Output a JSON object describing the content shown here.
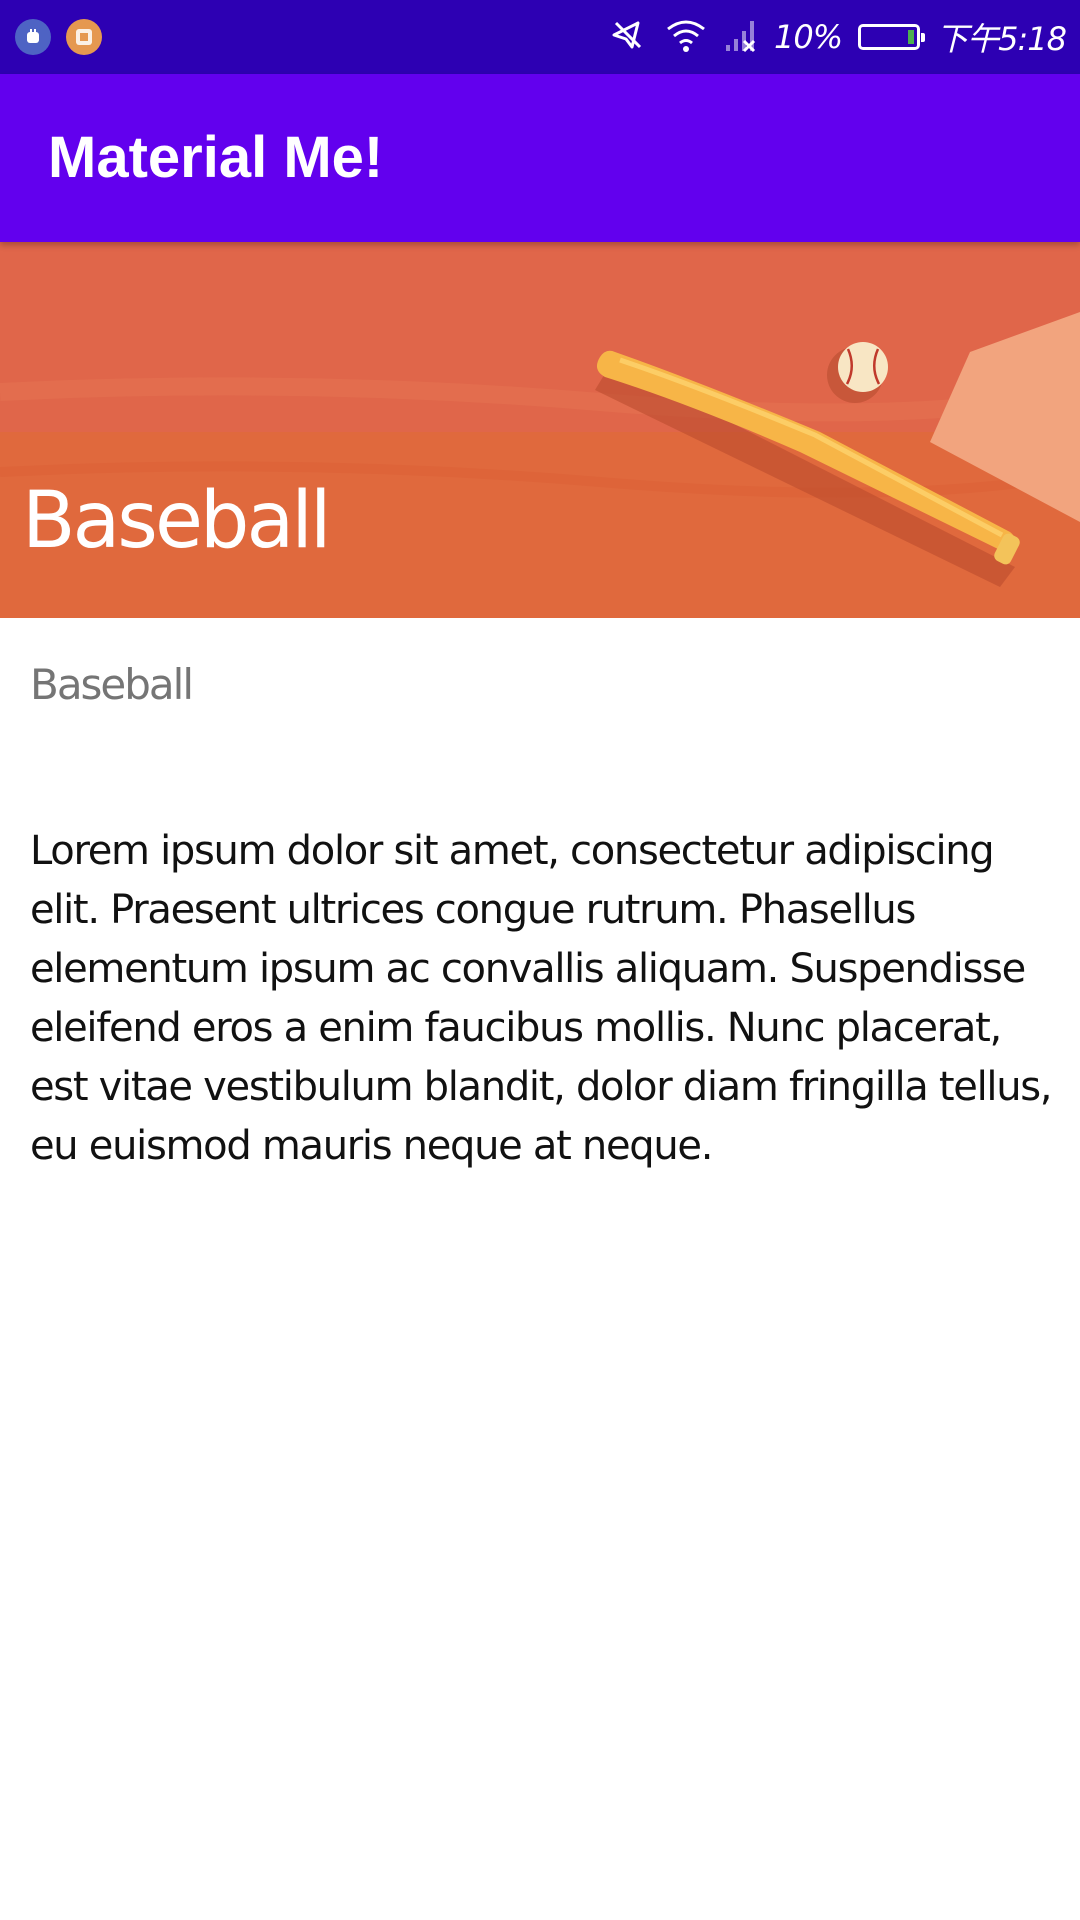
{
  "status_bar": {
    "notification_icons": [
      "app-notification-icon",
      "app-notification-icon"
    ],
    "icons": [
      "mute-icon",
      "wifi-icon",
      "signal-icon",
      "battery-icon"
    ],
    "battery_percent": "10%",
    "battery_level": 0.1,
    "time": "下午5:18",
    "colors": {
      "background": "#2d00b3"
    }
  },
  "app_bar": {
    "title": "Material Me!",
    "colors": {
      "background": "#6200ee"
    }
  },
  "hero": {
    "title": "Baseball",
    "image_subject": "baseball-bat-and-ball-illustration",
    "colors": {
      "background": "#e0664a"
    }
  },
  "detail": {
    "subtitle": "Baseball",
    "body": "Lorem ipsum dolor sit amet, consectetur adipiscing elit. Praesent ultrices congue rutrum. Phasellus elementum ipsum ac convallis aliquam. Suspendisse eleifend eros a enim faucibus mollis. Nunc placerat, est vitae vestibulum blandit, dolor diam fringilla tellus, eu euismod mauris neque at neque."
  }
}
